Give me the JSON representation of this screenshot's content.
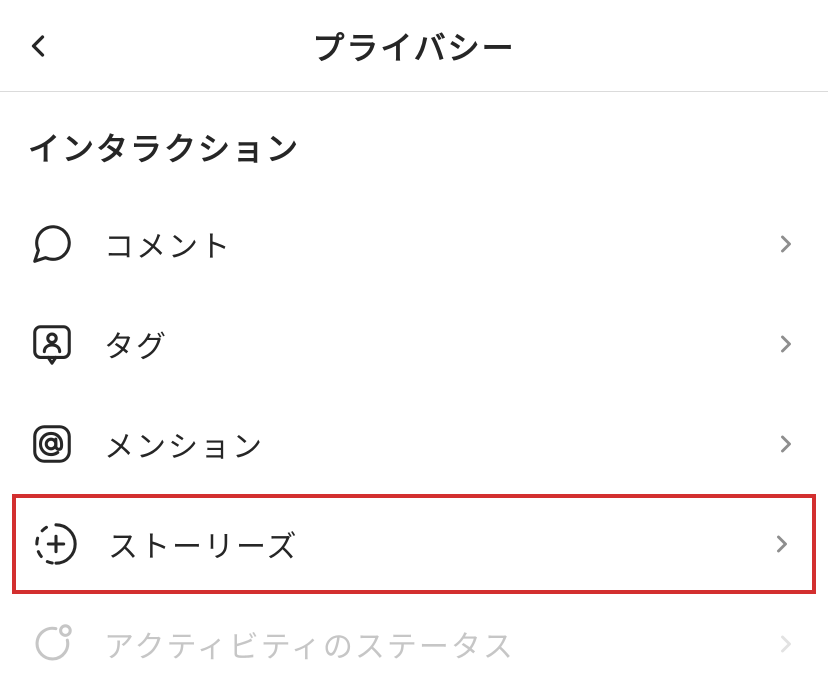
{
  "header": {
    "title": "プライバシー"
  },
  "section": {
    "title": "インタラクション"
  },
  "items": [
    {
      "label": "コメント"
    },
    {
      "label": "タグ"
    },
    {
      "label": "メンション"
    },
    {
      "label": "ストーリーズ"
    },
    {
      "label": "アクティビティのステータス"
    }
  ]
}
